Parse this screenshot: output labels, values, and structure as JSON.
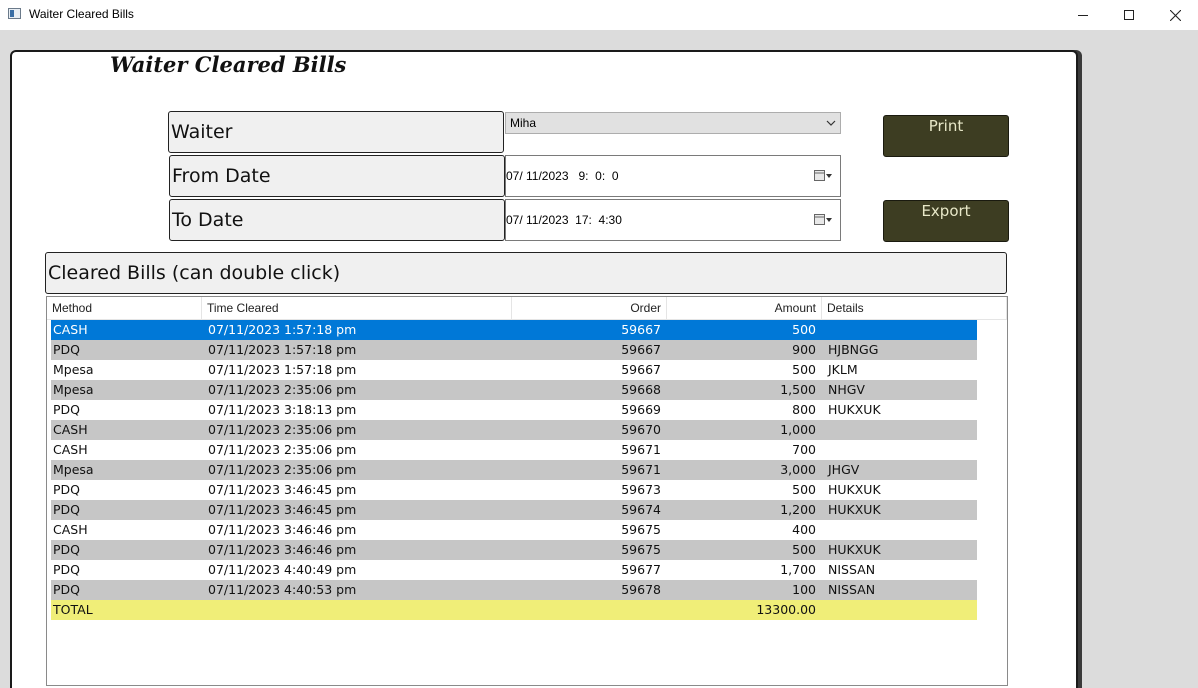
{
  "window": {
    "title": "Waiter Cleared Bills"
  },
  "form": {
    "title": "Waiter Cleared Bills",
    "waiter_label": "Waiter",
    "waiter_value": "Miha",
    "from_label": "From Date",
    "from_value": "07/ 11/2023   9:  0:  0",
    "to_label": "To Date",
    "to_value": "07/ 11/2023  17:  4:30",
    "print_label": "Print",
    "export_label": "Export",
    "list_caption": "Cleared Bills (can double click)"
  },
  "table": {
    "columns": {
      "method": "Method",
      "time": "Time Cleared",
      "order": "Order",
      "amount": "Amount",
      "details": "Details"
    },
    "rows": [
      {
        "method": "CASH",
        "time": "07/11/2023 1:57:18 pm",
        "order": "59667",
        "amount": "500",
        "details": ""
      },
      {
        "method": "PDQ",
        "time": "07/11/2023 1:57:18 pm",
        "order": "59667",
        "amount": "900",
        "details": "HJBNGG"
      },
      {
        "method": "Mpesa",
        "time": "07/11/2023 1:57:18 pm",
        "order": "59667",
        "amount": "500",
        "details": "JKLM"
      },
      {
        "method": "Mpesa",
        "time": "07/11/2023 2:35:06 pm",
        "order": "59668",
        "amount": "1,500",
        "details": "NHGV"
      },
      {
        "method": "PDQ",
        "time": "07/11/2023 3:18:13 pm",
        "order": "59669",
        "amount": "800",
        "details": "HUKXUK"
      },
      {
        "method": "CASH",
        "time": "07/11/2023 2:35:06 pm",
        "order": "59670",
        "amount": "1,000",
        "details": ""
      },
      {
        "method": "CASH",
        "time": "07/11/2023 2:35:06 pm",
        "order": "59671",
        "amount": "700",
        "details": ""
      },
      {
        "method": "Mpesa",
        "time": "07/11/2023 2:35:06 pm",
        "order": "59671",
        "amount": "3,000",
        "details": "JHGV"
      },
      {
        "method": "PDQ",
        "time": "07/11/2023 3:46:45 pm",
        "order": "59673",
        "amount": "500",
        "details": "HUKXUK"
      },
      {
        "method": "PDQ",
        "time": "07/11/2023 3:46:45 pm",
        "order": "59674",
        "amount": "1,200",
        "details": "HUKXUK"
      },
      {
        "method": "CASH",
        "time": "07/11/2023 3:46:46 pm",
        "order": "59675",
        "amount": "400",
        "details": ""
      },
      {
        "method": "PDQ",
        "time": "07/11/2023 3:46:46 pm",
        "order": "59675",
        "amount": "500",
        "details": "HUKXUK"
      },
      {
        "method": "PDQ",
        "time": "07/11/2023 4:40:49 pm",
        "order": "59677",
        "amount": "1,700",
        "details": "NISSAN"
      },
      {
        "method": "PDQ",
        "time": "07/11/2023 4:40:53 pm",
        "order": "59678",
        "amount": "100",
        "details": "NISSAN"
      }
    ],
    "total": {
      "label": "TOTAL",
      "amount": "13300.00"
    }
  },
  "colors": {
    "selected_row": "#0078d7",
    "alt_row": "#c6c6c6",
    "total_row": "#f0ee78",
    "button_bg": "#3d3d22"
  }
}
